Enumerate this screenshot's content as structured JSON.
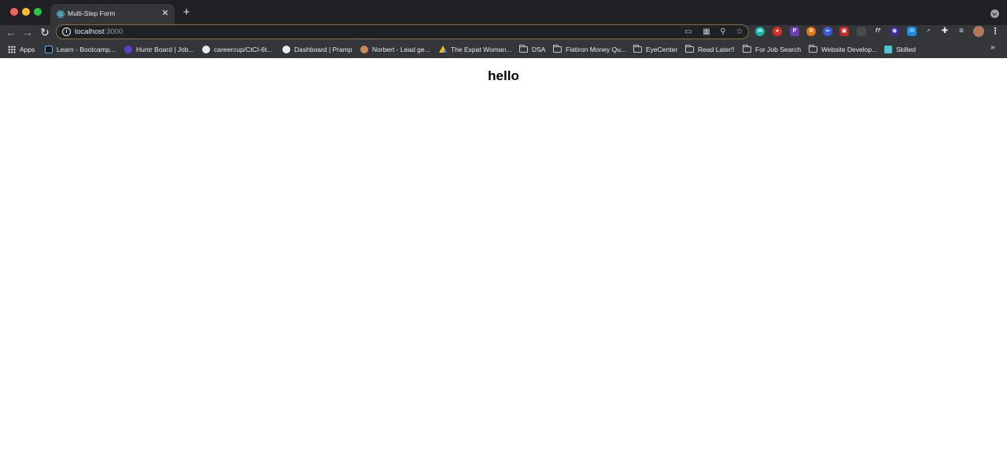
{
  "window": {
    "tab_title": "Multi-Step Form",
    "tab_favicon": "react-atom-icon"
  },
  "toolbar": {
    "url_host": "localhost",
    "url_port": ":3000"
  },
  "bookmarks": [
    {
      "label": "Apps",
      "icon": "apps-grid-icon"
    },
    {
      "label": "Learn - Bootcamp...",
      "icon": "learn-icon"
    },
    {
      "label": "Huntr Board | Job...",
      "icon": "huntr-icon"
    },
    {
      "label": "careercup/CtCI-6t...",
      "icon": "github-icon"
    },
    {
      "label": "Dashboard | Pramp",
      "icon": "pramp-icon"
    },
    {
      "label": "Norbert - Lead ge...",
      "icon": "norbert-icon"
    },
    {
      "label": "The Expat Woman...",
      "icon": "google-drive-icon"
    },
    {
      "label": "DSA",
      "icon": "folder-icon"
    },
    {
      "label": "Flatiron Money Qu...",
      "icon": "folder-icon"
    },
    {
      "label": "EyeCenter",
      "icon": "folder-icon"
    },
    {
      "label": "Read Later!!",
      "icon": "folder-icon"
    },
    {
      "label": "For Job Search",
      "icon": "folder-icon"
    },
    {
      "label": "Website Develop...",
      "icon": "folder-icon"
    },
    {
      "label": "Skilled",
      "icon": "skilled-icon"
    }
  ],
  "page": {
    "heading": "hello"
  }
}
